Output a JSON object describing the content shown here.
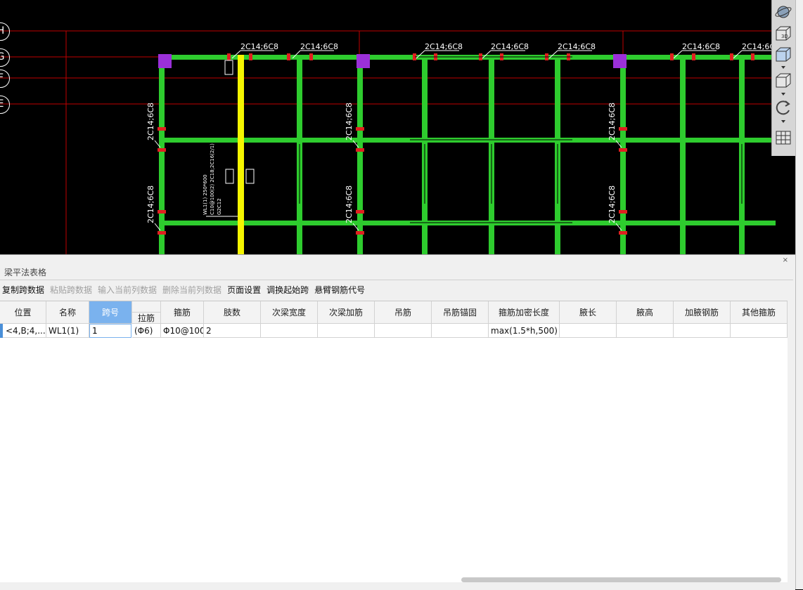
{
  "axes": [
    "H",
    "G",
    "F",
    "E"
  ],
  "beam_labels": {
    "top": [
      "2C14;6C8",
      "2C14;6C8",
      "2C14;6C8",
      "2C14;6C8",
      "2C14;6C8",
      "2C14;6C8",
      "2C14;6C"
    ],
    "vertical": [
      "2C14;6C8",
      "2C14;6C8",
      "2C14;6C8",
      "2C14;6C8",
      "2C14;6C8",
      "2C14;6C8"
    ],
    "selected_beam_annotation": [
      "WL1(1) 250*600",
      "C10@100(2) 2C18;2C16(2/1)",
      "G2C12"
    ]
  },
  "colors": {
    "beam": "#2ecc2e",
    "selected_beam": "#f5f500",
    "axis_line": "#c00000",
    "column": "#9b30d9",
    "rebar_marker": "#e02020"
  },
  "panel": {
    "title": "梁平法表格",
    "close_label": "×",
    "toolbar": [
      {
        "label": "复制跨数据",
        "enabled": true
      },
      {
        "label": "粘贴跨数据",
        "enabled": false
      },
      {
        "label": "输入当前列数据",
        "enabled": false
      },
      {
        "label": "删除当前列数据",
        "enabled": false
      },
      {
        "label": "页面设置",
        "enabled": true
      },
      {
        "label": "调换起始跨",
        "enabled": true
      },
      {
        "label": "悬臂钢筋代号",
        "enabled": true
      }
    ],
    "columns": [
      "位置",
      "名称",
      "跨号",
      "拉筋",
      "箍筋",
      "肢数",
      "次梁宽度",
      "次梁加筋",
      "吊筋",
      "吊筋锚固",
      "箍筋加密长度",
      "腋长",
      "腋高",
      "加腋钢筋",
      "其他箍筋"
    ],
    "selected_column": "跨号",
    "row": {
      "location": "<4,B;4,...",
      "name": "WL1(1)",
      "span": "1",
      "tie": "(Φ6)",
      "stirrup": "Φ10@100",
      "legs": "2",
      "sec_width": "",
      "sec_add": "",
      "hanger": "",
      "hanger_anchor": "",
      "dense_len": "max(1.5*h,500)",
      "haunch_len": "",
      "haunch_h": "",
      "haunch_bar": "",
      "other_stirrup": ""
    }
  },
  "view_toolbar": [
    "orbit-icon",
    "3d-view-icon",
    "box-view-icon",
    "box-small-icon",
    "rotate-icon",
    "grid-table-icon"
  ]
}
